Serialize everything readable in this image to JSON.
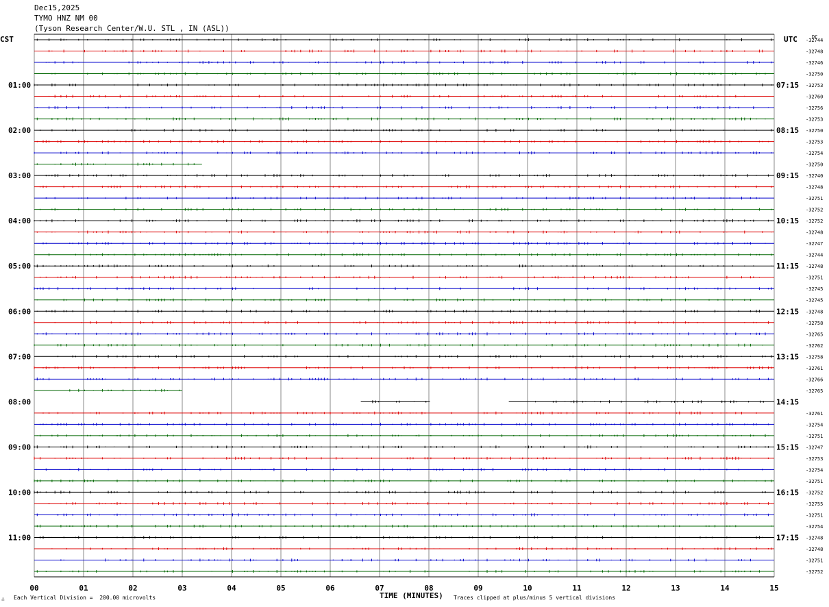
{
  "header": {
    "date": "Dec15,2025",
    "station": "TYMO HNZ NM 00",
    "location": "(Tyson Research Center/W.U. STL , IN (ASL))"
  },
  "left_timezone": "CST",
  "right_timezone": "UTC",
  "dc_label": "DC",
  "chart_data": {
    "type": "line",
    "title": "",
    "xlabel": "TIME (MINUTES)",
    "xlim": [
      0,
      15
    ],
    "x_ticks": [
      "00",
      "01",
      "02",
      "03",
      "04",
      "05",
      "06",
      "07",
      "08",
      "09",
      "10",
      "11",
      "12",
      "13",
      "14",
      "15"
    ],
    "trace_colors": [
      "#000000",
      "#dd0000",
      "#0000cc",
      "#006600"
    ],
    "rows": 48,
    "minutes_per_row": 15,
    "left_hour_labels": [
      "01:00",
      "02:00",
      "03:00",
      "04:00",
      "05:00",
      "06:00",
      "07:00",
      "08:00",
      "09:00",
      "10:00",
      "11:00"
    ],
    "right_hour_labels": [
      "07:15",
      "08:15",
      "09:15",
      "10:15",
      "11:15",
      "12:15",
      "13:15",
      "14:15",
      "15:15",
      "16:15",
      "17:15"
    ],
    "dc_offsets": [
      "-32744",
      "-32748",
      "-32746",
      "-32750",
      "-32753",
      "-32760",
      "-32756",
      "-32753",
      "-32750",
      "-32753",
      "-32754",
      "-32750",
      "-32740",
      "-32748",
      "-32751",
      "-32752",
      "-32752",
      "-32748",
      "-32747",
      "-32744",
      "-32748",
      "-32751",
      "-32745",
      "-32745",
      "-32748",
      "-32758",
      "-32765",
      "-32762",
      "-32758",
      "-32761",
      "-32766",
      "-32765",
      "",
      "-32761",
      "-32754",
      "-32751",
      "-32747",
      "-32753",
      "-32754",
      "-32751",
      "-32752",
      "-32755",
      "-32751",
      "-32754",
      "-32748",
      "-32748",
      "-32751",
      "-32752"
    ],
    "gaps": [
      {
        "row": 11,
        "from_minute": 3.4,
        "to_minute": 15
      },
      {
        "row": 31,
        "from_minute": 3.0,
        "to_minute": 15
      },
      {
        "row": 32,
        "from_minute": 0,
        "to_minute": 6.6
      },
      {
        "row": 32,
        "from_minute": 8.0,
        "to_minute": 9.6
      }
    ]
  },
  "footer": {
    "scale_note": "Each Vertical Division =  200.00 microvolts",
    "clip_note": "Traces clipped at plus/minus 5 vertical divisions",
    "corner_mark": "∴"
  }
}
